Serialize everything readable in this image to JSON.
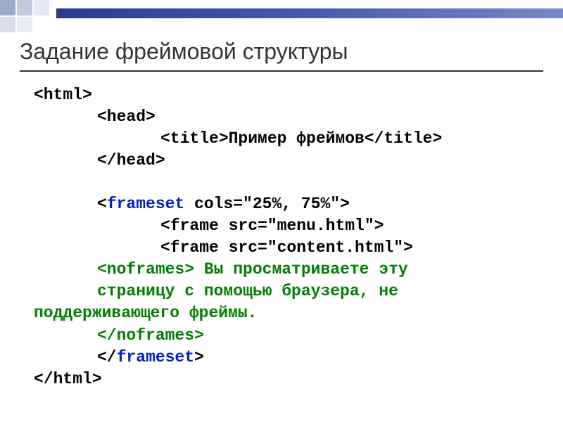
{
  "slide": {
    "title": "Задание фреймовой структуры"
  },
  "code": {
    "l1_open_html": "<html>",
    "l2_open_head": "<head>",
    "l3_title_open": "<title>",
    "l3_title_text": "Пример фреймов",
    "l3_title_close": "</title>",
    "l4_close_head": "</head>",
    "l5_blank": " ",
    "l6_frameset_open": "<",
    "l6_frameset_tag": "frameset",
    "l6_frameset_attrs": " cols=\"25%, 75%\">",
    "l7_frame1": "<frame src=\"menu.html\">",
    "l8_frame2": "<frame src=\"content.html\">",
    "l9_noframes_open": "<noframes>",
    "l9_noframes_text1": " Вы просматриваете эту",
    "l10_noframes_text2": "страницу с помощью браузера, не",
    "l11_noframes_text3": "поддерживающего фреймы.",
    "l12_noframes_close": "</noframes>",
    "l13_frameset_close_open": "</",
    "l13_frameset_close_tag": "frameset",
    "l13_frameset_close_end": ">",
    "l14_close_html": "</html>"
  }
}
